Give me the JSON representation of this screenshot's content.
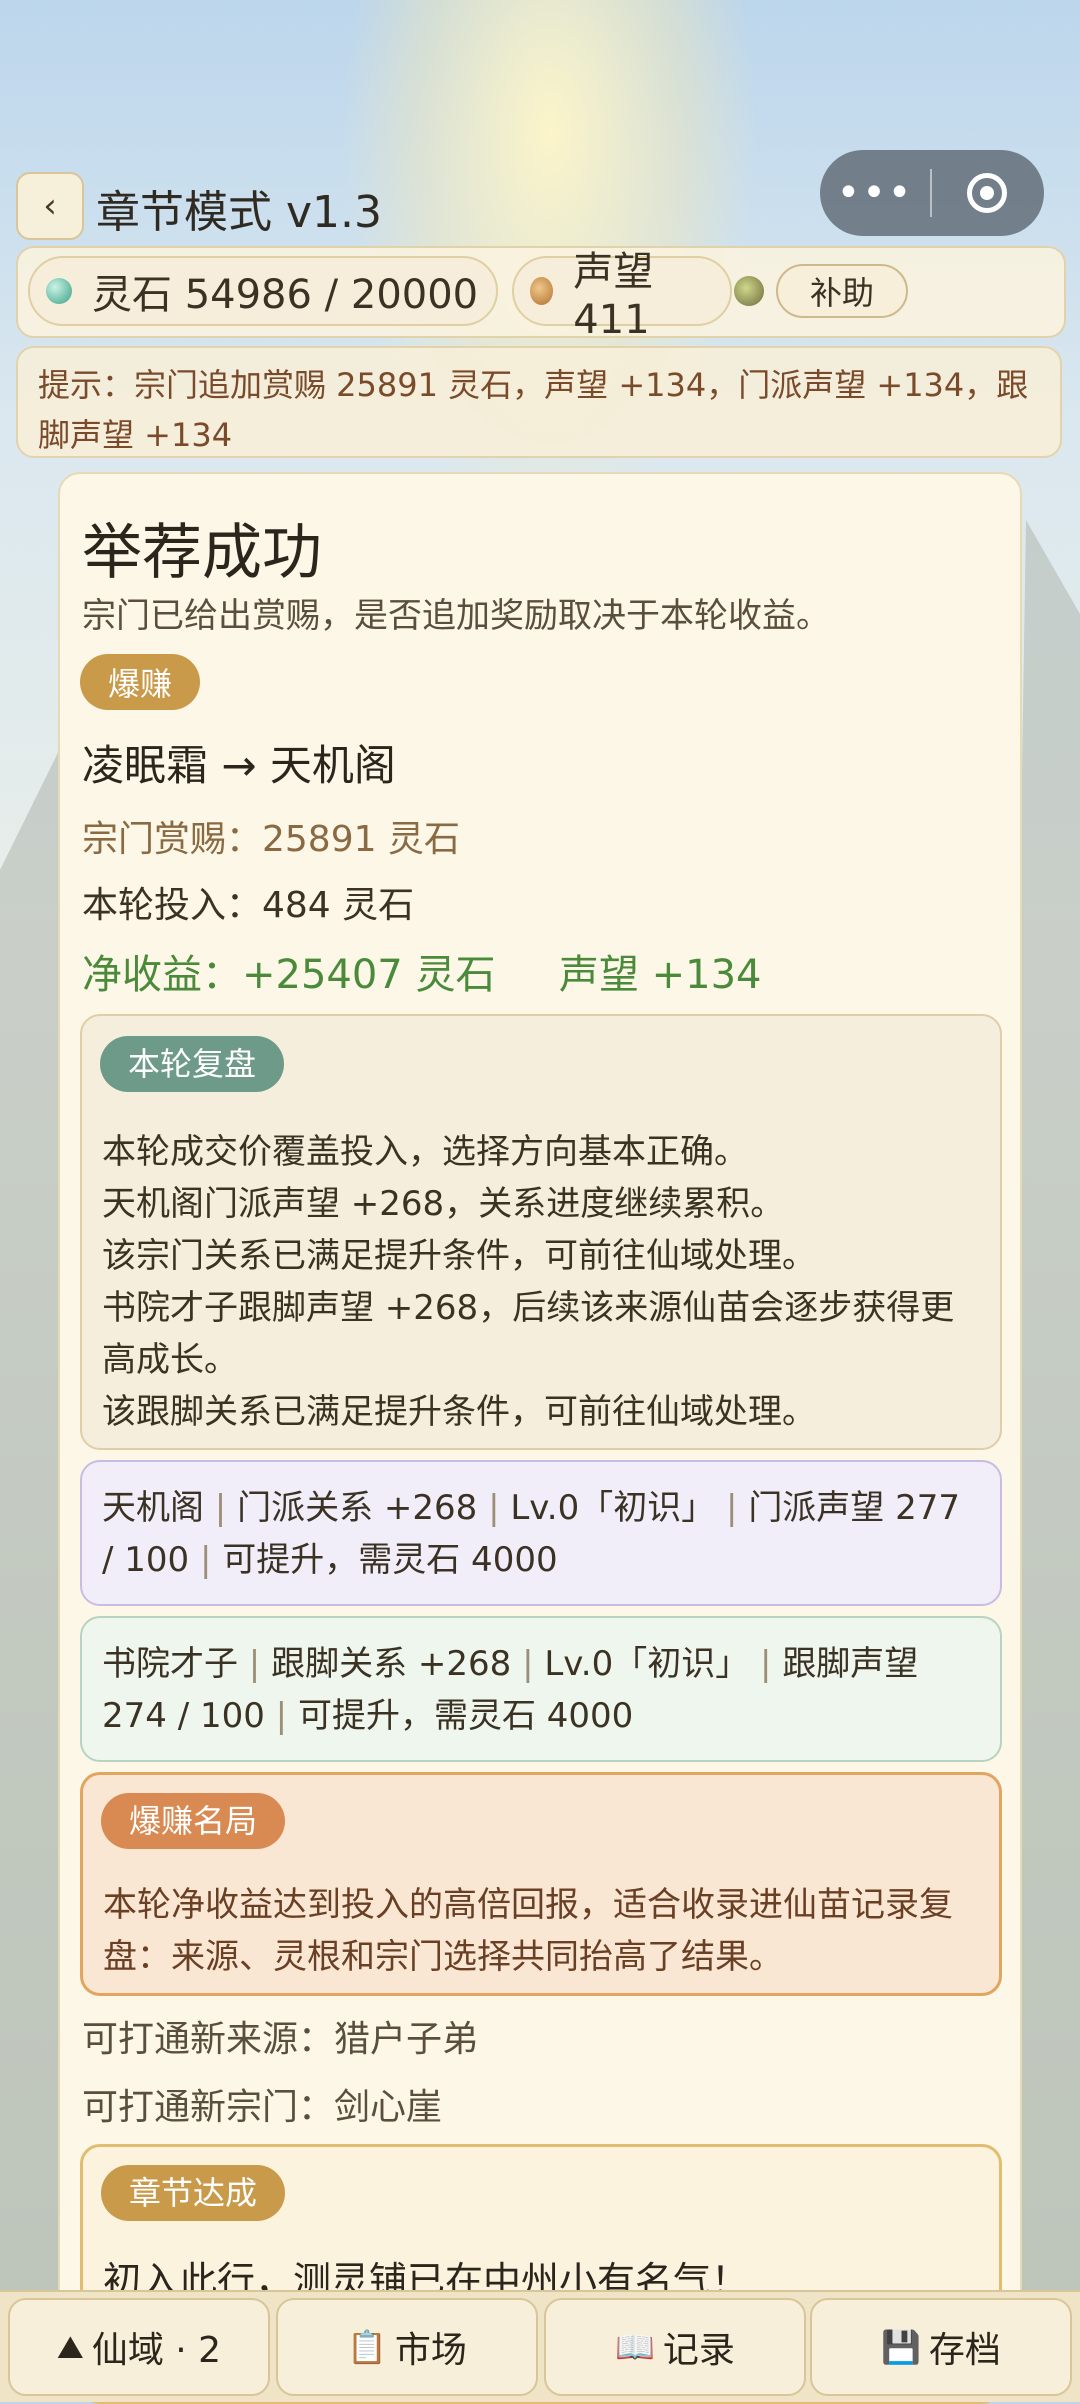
{
  "header": {
    "back_icon": "‹",
    "title": "章节模式 v1.3",
    "capsule_more": "•••"
  },
  "stats": {
    "spirit_stone": "灵石 54986 / 20000",
    "prestige": "声望 411",
    "help_label": "补助"
  },
  "hint": "提示：宗门追加赏赐 25891 灵石，声望 +134，门派声望 +134，跟脚声望 +134",
  "card": {
    "title": "举荐成功",
    "subtitle": "宗门已给出赏赐，是否追加奖励取决于本轮收益。",
    "badge": "爆赚",
    "route": "凌眠霜 → 天机阁",
    "reward": "宗门赏赐：25891 灵石",
    "invest": "本轮投入：484 灵石",
    "net_gain": "净收益：+25407 灵石",
    "net_prestige": "声望 +134",
    "review": {
      "badge": "本轮复盘",
      "lines": [
        "本轮成交价覆盖投入，选择方向基本正确。",
        "天机阁门派声望 +268，关系进度继续累积。",
        "该宗门关系已满足提升条件，可前往仙域处理。",
        "书院才子跟脚声望 +268，后续该来源仙苗会逐步获得更高成长。",
        "该跟脚关系已满足提升条件，可前往仙域处理。"
      ]
    },
    "sect_a": [
      "天机阁",
      "门派关系 +268",
      "Lv.0「初识」",
      "门派声望 277 / 100",
      "可提升，需灵石 4000"
    ],
    "sect_b": [
      "书院才子",
      "跟脚关系 +268",
      "Lv.0「初识」",
      "跟脚声望 274 / 100",
      "可提升，需灵石 4000"
    ],
    "big_win": {
      "badge": "爆赚名局",
      "text": "本轮净收益达到投入的高倍回报，适合收录进仙苗记录复盘：来源、灵根和宗门选择共同抬高了结果。"
    },
    "open_source": "可打通新来源：猎户子弟",
    "open_sect": "可打通新宗门：剑心崖",
    "chapter": {
      "badge": "章节达成",
      "text": "初入此行，测灵铺已在中州小有名气！"
    }
  },
  "nav": [
    {
      "icon": "mountain-icon",
      "glyph": "⛰",
      "label": "仙域 · 2"
    },
    {
      "icon": "clipboard-icon",
      "glyph": "📋",
      "label": "市场"
    },
    {
      "icon": "book-icon",
      "glyph": "📖",
      "label": "记录"
    },
    {
      "icon": "floppy-disk-icon",
      "glyph": "💾",
      "label": "存档"
    }
  ]
}
